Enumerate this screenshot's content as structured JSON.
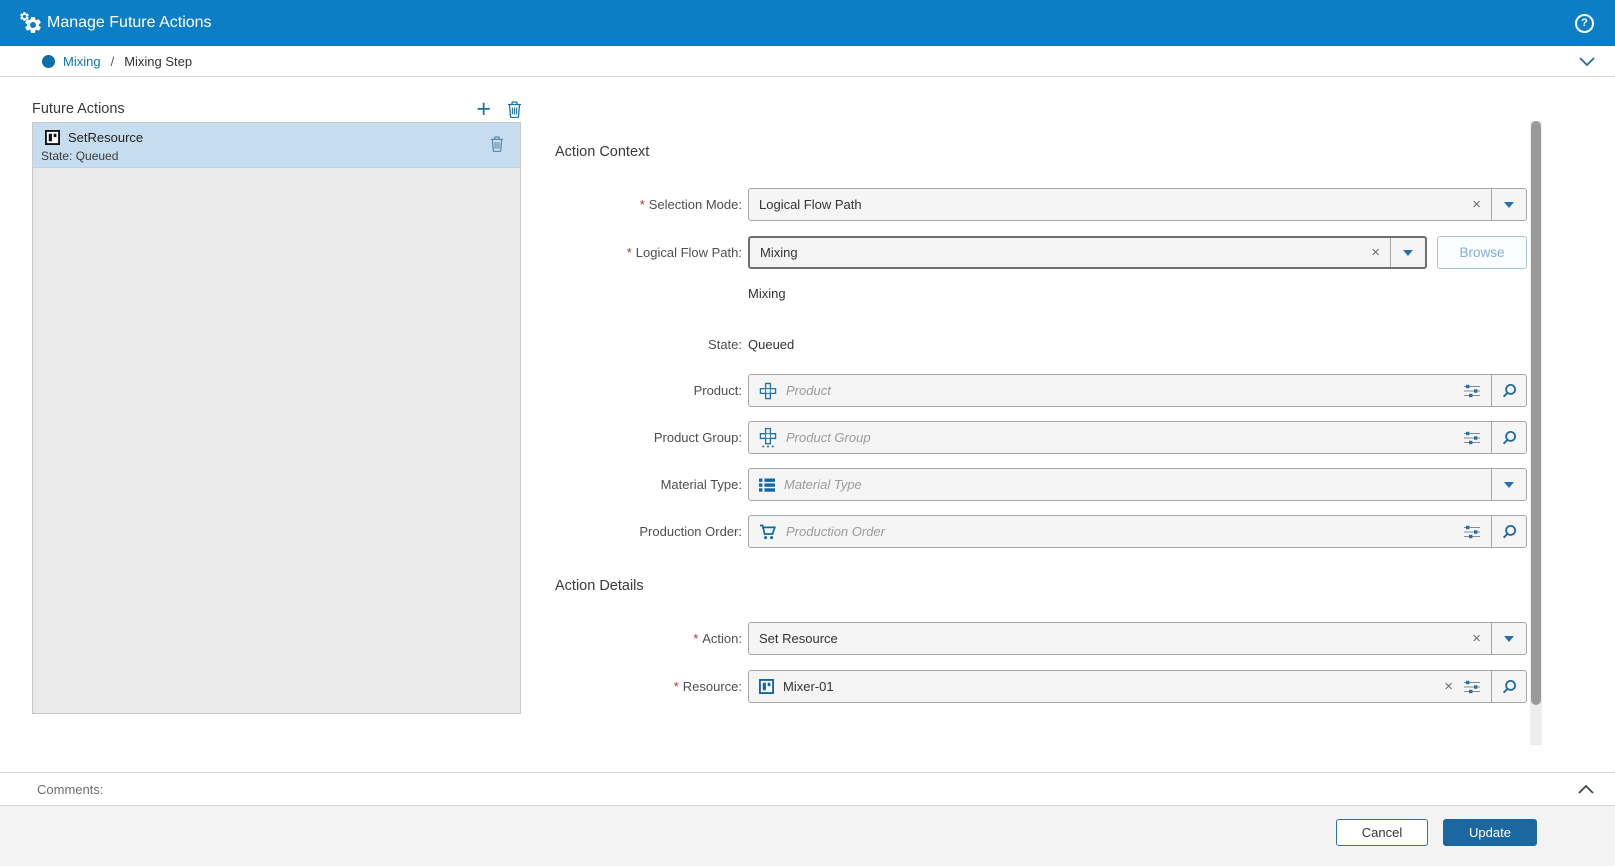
{
  "glyphs": {
    "required": "*",
    "clear": "×",
    "plus": "+",
    "help": "?",
    "separator": "/"
  },
  "header": {
    "title": "Manage Future Actions"
  },
  "breadcrumb": {
    "context": "Mixing",
    "page": "Mixing Step"
  },
  "panel": {
    "title": "Future Actions",
    "item": {
      "name": "SetResource",
      "state": "State: Queued"
    }
  },
  "sections": {
    "context": "Action Context",
    "details": "Action Details"
  },
  "form": {
    "selection_mode": {
      "label": "Selection Mode:",
      "value": "Logical Flow Path"
    },
    "logical_flow_path": {
      "label": "Logical Flow Path:",
      "value": "Mixing",
      "helper": "Mixing",
      "browse": "Browse"
    },
    "state": {
      "label": "State:",
      "value": "Queued"
    },
    "product": {
      "label": "Product:",
      "placeholder": "Product"
    },
    "product_group": {
      "label": "Product Group:",
      "placeholder": "Product Group"
    },
    "material_type": {
      "label": "Material Type:",
      "placeholder": "Material Type"
    },
    "production_order": {
      "label": "Production Order:",
      "placeholder": "Production Order"
    },
    "action": {
      "label": "Action:",
      "value": "Set Resource"
    },
    "resource": {
      "label": "Resource:",
      "value": "Mixer-01"
    }
  },
  "comments": {
    "label": "Comments:"
  },
  "footer": {
    "cancel": "Cancel",
    "update": "Update"
  },
  "colors": {
    "header_bar": "#0C7EC5",
    "accent_blue": "#1F6FA8",
    "update_button": "#1B68A0",
    "selected_item": "#C6DDEF",
    "link_blue": "#0E72B4",
    "required_red": "#B3312B"
  }
}
